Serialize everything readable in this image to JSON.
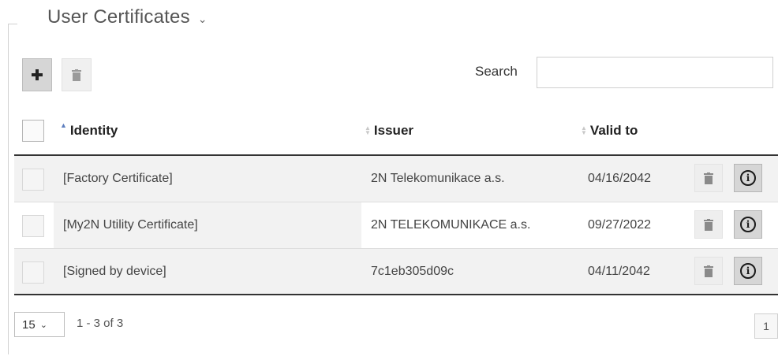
{
  "section": {
    "title": "User Certificates",
    "expand_icon": "chevron-down-icon"
  },
  "toolbar": {
    "add_icon": "plus-icon",
    "delete_icon": "trash-icon"
  },
  "search": {
    "label": "Search",
    "value": "",
    "placeholder": ""
  },
  "table": {
    "columns": [
      {
        "label": "Identity",
        "sort": "ascending"
      },
      {
        "label": "Issuer",
        "sort": "none"
      },
      {
        "label": "Valid to",
        "sort": "none"
      }
    ],
    "rows": [
      {
        "identity": "[Factory Certificate]",
        "issuer": "2N Telekomunikace a.s.",
        "valid_to": "04/16/2042"
      },
      {
        "identity": "[My2N Utility Certificate]",
        "issuer": "2N TELEKOMUNIKACE a.s.",
        "valid_to": "09/27/2022"
      },
      {
        "identity": "[Signed by device]",
        "issuer": "7c1eb305d09c",
        "valid_to": "04/11/2042"
      }
    ],
    "row_actions": [
      "trash-icon",
      "info-icon"
    ]
  },
  "pagination": {
    "page_size": "15",
    "range": "1 - 3 of 3",
    "current_page": "1"
  }
}
